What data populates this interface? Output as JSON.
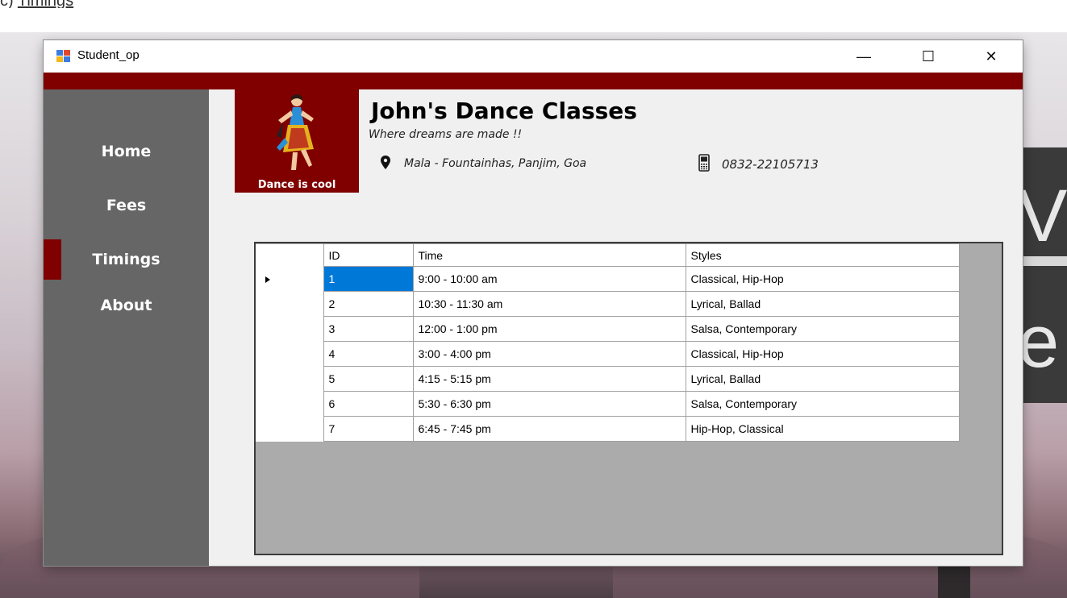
{
  "background": {
    "heading_fragment": "Timings",
    "deco_letters": [
      "V",
      "e"
    ]
  },
  "window": {
    "title": "Student_op",
    "controls": {
      "minimize": "—",
      "maximize": "☐",
      "close": "✕"
    },
    "accent_color": "#800000"
  },
  "sidebar": {
    "items": [
      {
        "label": "Home",
        "active": false
      },
      {
        "label": "Fees",
        "active": false
      },
      {
        "label": "Timings",
        "active": true
      },
      {
        "label": "About",
        "active": false
      }
    ],
    "bg_color": "#666666"
  },
  "header": {
    "logo_caption": "Dance is cool",
    "title": "John's Dance Classes",
    "tagline": "Where dreams are made !!",
    "address": "Mala - Fountainhas, Panjim, Goa",
    "phone": "0832-22105713"
  },
  "timings_table": {
    "columns": [
      "ID",
      "Time",
      "Styles"
    ],
    "selected_row": 0,
    "rows": [
      {
        "id": "1",
        "time": "9:00 - 10:00 am",
        "styles": "Classical, Hip-Hop"
      },
      {
        "id": "2",
        "time": "10:30 - 11:30 am",
        "styles": "Lyrical, Ballad"
      },
      {
        "id": "3",
        "time": "12:00 - 1:00 pm",
        "styles": "Salsa, Contemporary"
      },
      {
        "id": "4",
        "time": "3:00 - 4:00 pm",
        "styles": "Classical, Hip-Hop"
      },
      {
        "id": "5",
        "time": "4:15 - 5:15 pm",
        "styles": "Lyrical, Ballad"
      },
      {
        "id": "6",
        "time": "5:30 - 6:30 pm",
        "styles": "Salsa, Contemporary"
      },
      {
        "id": "7",
        "time": "6:45 - 7:45 pm",
        "styles": "Hip-Hop, Classical"
      }
    ]
  }
}
